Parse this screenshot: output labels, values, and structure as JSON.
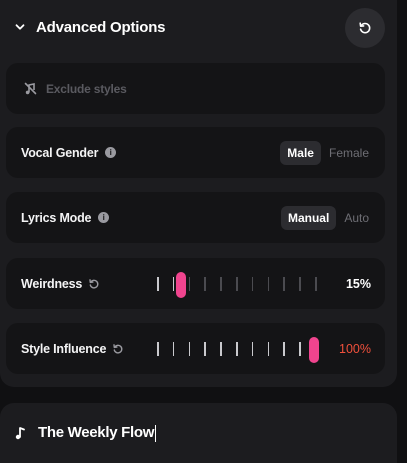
{
  "header": {
    "title": "Advanced Options",
    "chevron_icon": "chevron-down-icon",
    "reset_icon": "reset-icon"
  },
  "exclude": {
    "placeholder": "Exclude styles",
    "icon": "music-off-icon"
  },
  "vocal_gender": {
    "label": "Vocal Gender",
    "options": [
      "Male",
      "Female"
    ],
    "selected": "Male"
  },
  "lyrics_mode": {
    "label": "Lyrics Mode",
    "options": [
      "Manual",
      "Auto"
    ],
    "selected": "Manual"
  },
  "weirdness": {
    "label": "Weirdness",
    "value_text": "15%",
    "value": 15
  },
  "style_influence": {
    "label": "Style Influence",
    "value_text": "100%",
    "value": 100
  },
  "song_title": {
    "value": "The Weekly Flow",
    "icon": "music-note-icon"
  },
  "colors": {
    "accent": "#f0448e",
    "max_value": "#f0503c",
    "panel": "#1c1c1f",
    "card": "#141416"
  }
}
